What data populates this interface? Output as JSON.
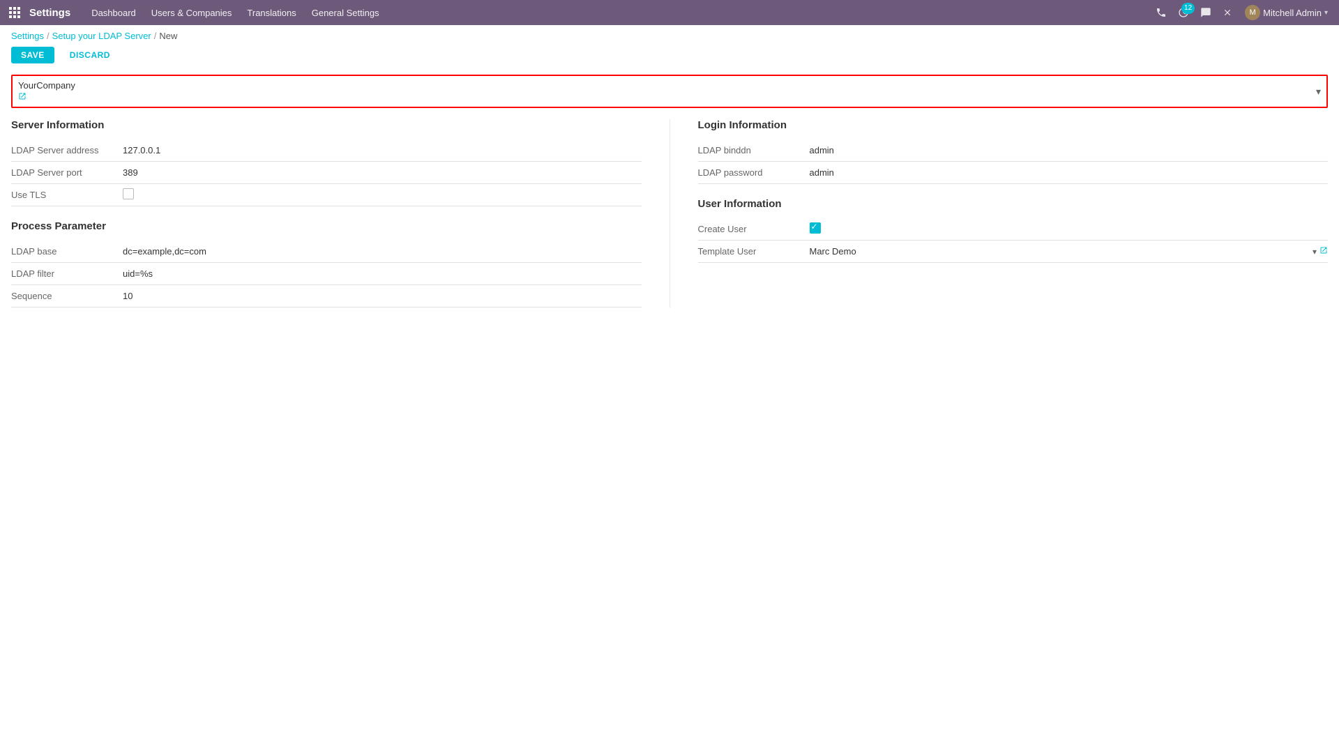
{
  "app": {
    "title": "Settings"
  },
  "navbar": {
    "menu_items": [
      {
        "label": "Dashboard",
        "id": "dashboard"
      },
      {
        "label": "Users & Companies",
        "id": "users-companies"
      },
      {
        "label": "Translations",
        "id": "translations"
      },
      {
        "label": "General Settings",
        "id": "general-settings"
      }
    ],
    "icons": {
      "phone": "📞",
      "clock": "🕐",
      "clock_badge": "12",
      "chat": "💬",
      "close": "✕"
    },
    "user": {
      "name": "Mitchell Admin",
      "avatar_initials": "M"
    }
  },
  "breadcrumb": {
    "items": [
      {
        "label": "Settings",
        "link": true
      },
      {
        "label": "Setup your LDAP Server",
        "link": true
      },
      {
        "label": "New",
        "link": false
      }
    ]
  },
  "actions": {
    "save_label": "SAVE",
    "discard_label": "DISCARD"
  },
  "company_selector": {
    "name": "YourCompany",
    "dropdown_arrow": "▾"
  },
  "server_info": {
    "title": "Server Information",
    "fields": [
      {
        "label": "LDAP Server address",
        "value": "127.0.0.1"
      },
      {
        "label": "LDAP Server port",
        "value": "389"
      },
      {
        "label": "Use TLS",
        "value": "",
        "type": "checkbox",
        "checked": false
      }
    ]
  },
  "process_parameter": {
    "title": "Process Parameter",
    "fields": [
      {
        "label": "LDAP base",
        "value": "dc=example,dc=com"
      },
      {
        "label": "LDAP filter",
        "value": "uid=%s"
      },
      {
        "label": "Sequence",
        "value": "10"
      }
    ]
  },
  "login_info": {
    "title": "Login Information",
    "fields": [
      {
        "label": "LDAP binddn",
        "value": "admin"
      },
      {
        "label": "LDAP password",
        "value": "admin"
      }
    ]
  },
  "user_info": {
    "title": "User Information",
    "create_user_label": "Create User",
    "create_user_checked": true,
    "template_user_label": "Template User",
    "template_user_value": "Marc Demo"
  }
}
